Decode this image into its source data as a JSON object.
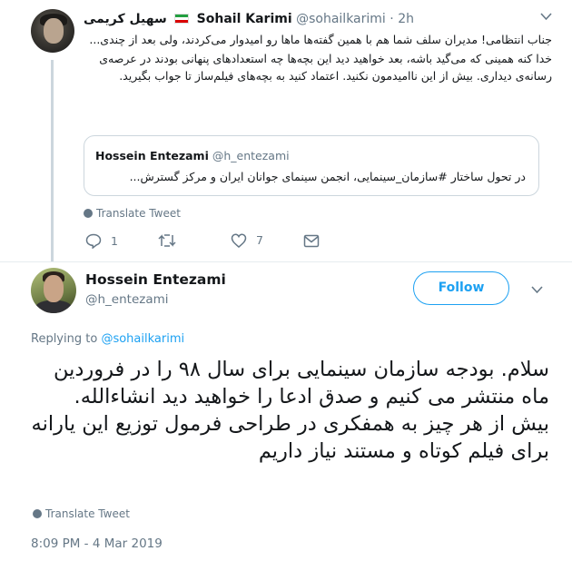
{
  "parent_tweet": {
    "display_name_fa": "سهیل کریمی",
    "display_name_en": "Sohail Karimi",
    "handle": "@sohailkarimi",
    "separator": "·",
    "time": "2h",
    "paragraphs": [
      "جناب انتظامی! مدیران سلف شما هم با همین گفته‌ها ماها رو امیدوار می‌کردند، ولی بعد از چندی...",
      "خدا کنه همینی که می‌گید باشه، بعد خواهید دید این بچه‌ها چه استعدادهای پنهانی بودند در عرصه‌ی رسانه‌ی دیداری. بیش از این ناامیدمون نکنید. اعتماد کنید به بچه‌های فیلم‌ساز تا جواب بگیرید."
    ],
    "quoted": {
      "name": "Hossein Entezami",
      "handle": "@h_entezami",
      "text": "در تحول ساختار #سازمان_سینمایی، انجمن سینمای جوانان ایران و مرکز گسترش..."
    },
    "translate_label": "Translate Tweet",
    "reply_count": "1",
    "like_count": "7"
  },
  "main_tweet": {
    "name": "Hossein Entezami",
    "handle": "@h_entezami",
    "follow_label": "Follow",
    "replying_prefix": "Replying to",
    "replying_handle": "@sohailkarimi",
    "paragraphs": [
      "سلام. بودجه سازمان سینمایی برای سال ۹۸ را در فروردین ماه منتشر می کنیم و صدق ادعا را خواهید دید انشاءالله.",
      "بیش از هر چیز به همفکری در طراحی فرمول توزیع این یارانه برای فیلم کوتاه و مستند نیاز داریم"
    ],
    "translate_label": "Translate Tweet",
    "timestamp": "8:09 PM - 4 Mar 2019"
  },
  "colors": {
    "accent": "#1da1f2",
    "secondary_text": "#657786",
    "border": "#ccd6dd",
    "flag_green": "#239f40",
    "flag_red": "#da0000"
  },
  "icons": [
    "chevron-down-icon",
    "iran-flag-icon",
    "globe-icon",
    "reply-icon",
    "retweet-icon",
    "like-icon",
    "message-icon"
  ]
}
